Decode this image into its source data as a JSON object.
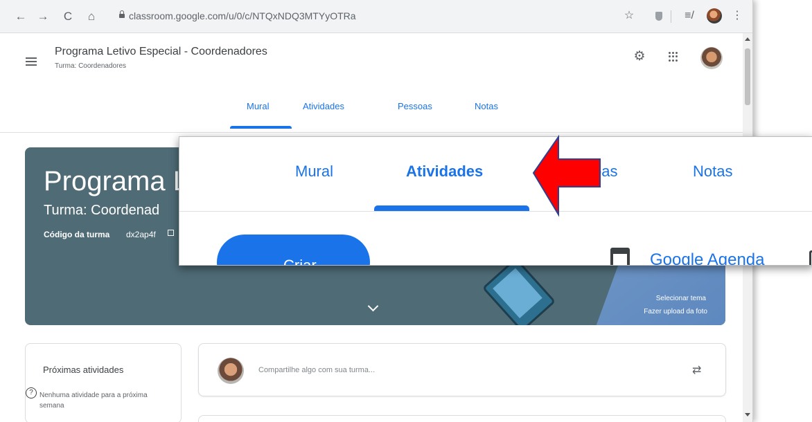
{
  "browser": {
    "url": "classroom.google.com/u/0/c/NTQxNDQ3MTYyOTRa",
    "nav": {
      "back": "←",
      "forward": "→",
      "reload": "C",
      "home": "⌂"
    },
    "icons": {
      "star": "☆",
      "queue": "≡/",
      "menu": "⋮"
    }
  },
  "header": {
    "class_title": "Programa Letivo Especial - Coordenadores",
    "class_subtitle": "Turma: Coordenadores",
    "tabs": [
      "Mural",
      "Atividades",
      "Pessoas",
      "Notas"
    ],
    "gear_glyph": "⚙"
  },
  "banner": {
    "title": "Programa L",
    "subtitle": "Turma: Coordenad",
    "code_label": "Código da turma",
    "code_value": "dx2ap4f",
    "select_theme": "Selecionar tema",
    "upload_photo": "Fazer upload da foto"
  },
  "upcoming": {
    "title": "Próximas atividades",
    "help_glyph": "?",
    "empty_text": "Nenhuma atividade para a próxima semana"
  },
  "stream": {
    "placeholder": "Compartilhe algo com sua turma...",
    "repost_glyph": "⇄"
  },
  "zoom": {
    "tabs": [
      "Mural",
      "Atividades",
      "ssoas",
      "Notas"
    ],
    "create_label": "Criar",
    "agenda_label": "Google Agenda"
  },
  "colors": {
    "accent": "#1a73e8",
    "banner": "#4f6b76",
    "arrow": "#ff0000"
  }
}
